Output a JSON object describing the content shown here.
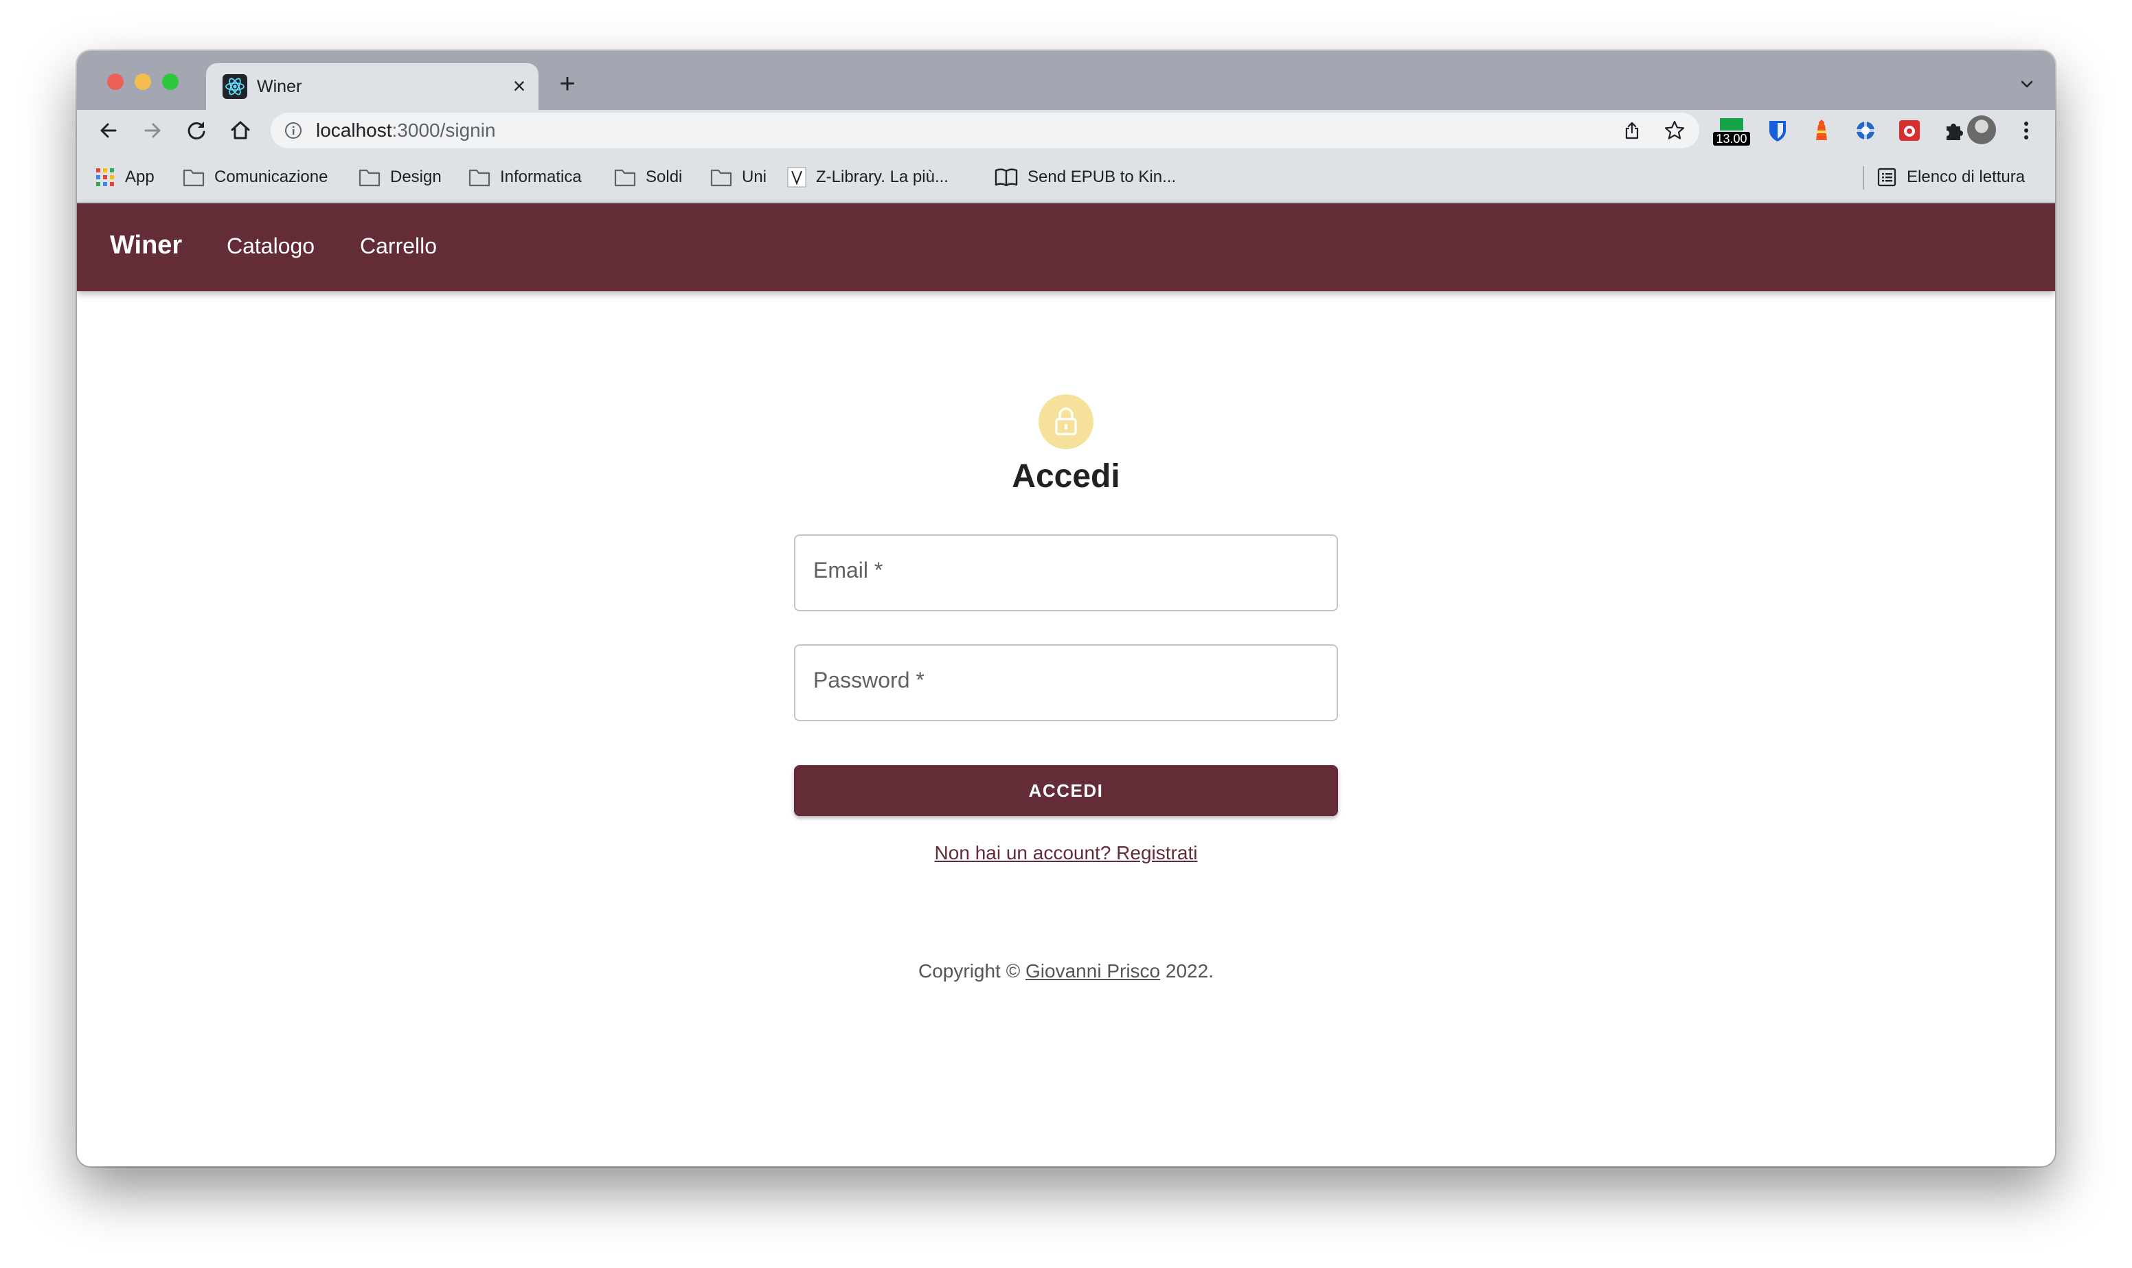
{
  "browser": {
    "tab": {
      "title": "Winer",
      "favicon": "react-logo-icon",
      "close_glyph": "×"
    },
    "new_tab_glyph": "+",
    "address": {
      "host": "localhost",
      "path": ":3000/signin"
    },
    "extension_badge": "13.00",
    "bookmarks": [
      {
        "label": "App",
        "icon": "apps-grid-icon"
      },
      {
        "label": "Comunicazione",
        "icon": "folder-icon"
      },
      {
        "label": "Design",
        "icon": "folder-icon"
      },
      {
        "label": "Informatica",
        "icon": "folder-icon"
      },
      {
        "label": "Soldi",
        "icon": "folder-icon"
      },
      {
        "label": "Uni",
        "icon": "folder-icon"
      },
      {
        "label": "Z-Library. La più...",
        "icon": "z-library-icon"
      },
      {
        "label": "Send EPUB to Kin...",
        "icon": "book-icon"
      }
    ],
    "reading_list": "Elenco di lettura"
  },
  "appbar": {
    "brand": "Winer",
    "links": [
      "Catalogo",
      "Carrello"
    ]
  },
  "signin": {
    "title": "Accedi",
    "email_label": "Email *",
    "password_label": "Password *",
    "submit": "ACCEDI",
    "signup_link": "Non hai un account? Registrati"
  },
  "footer": {
    "prefix": "Copyright © ",
    "author": "Giovanni Prisco",
    "suffix": " 2022."
  },
  "colors": {
    "primary": "#632c36",
    "lock_avatar": "#f5e19a"
  }
}
